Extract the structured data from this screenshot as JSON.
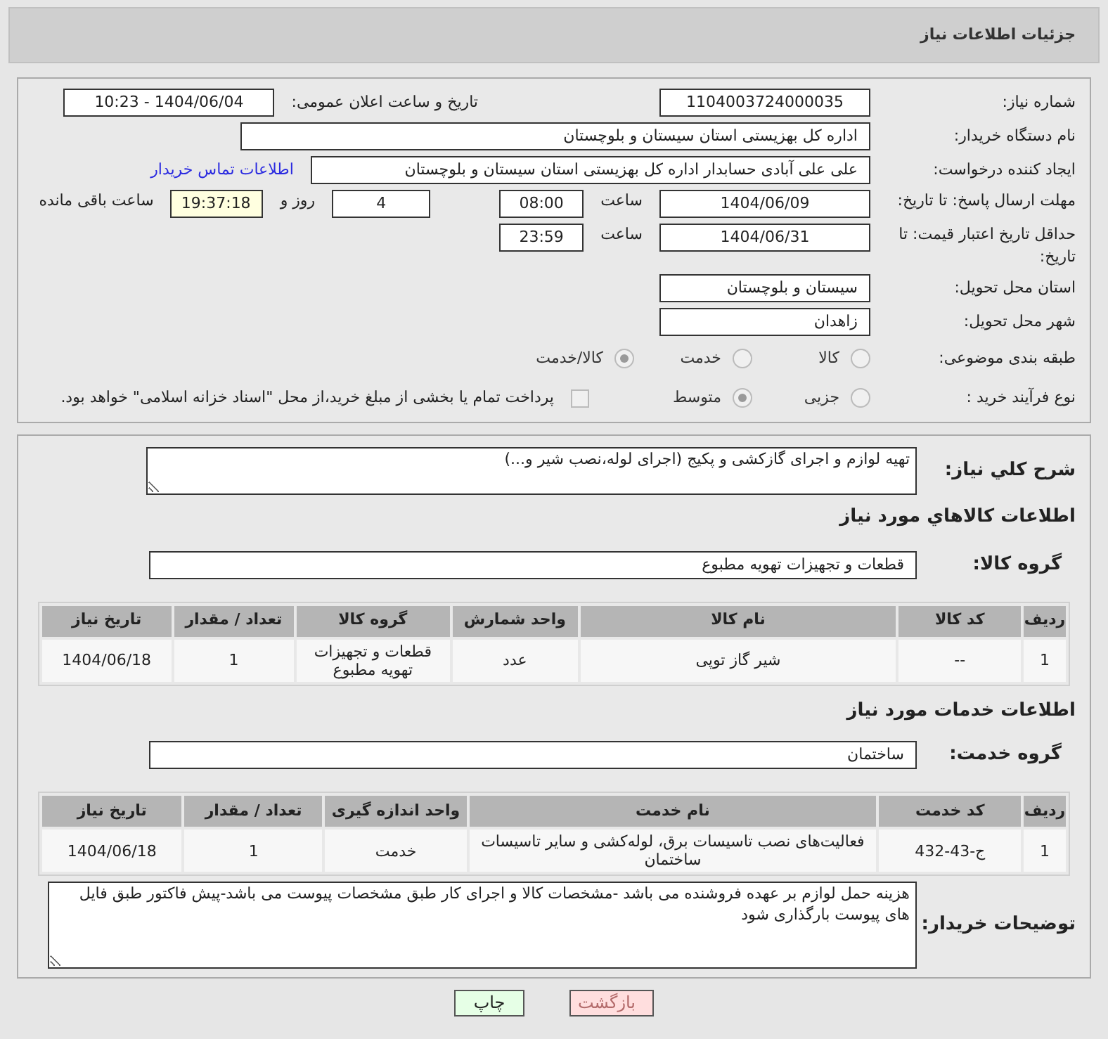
{
  "header": {
    "title": "جزئیات اطلاعات نیاز"
  },
  "need_number": {
    "label": "شماره نیاز:",
    "value": "1104003724000035"
  },
  "announce": {
    "label": "تاریخ و ساعت اعلان عمومی:",
    "value": "1404/06/04 - 10:23"
  },
  "buyer_org": {
    "label": "نام دستگاه خریدار:",
    "value": "اداره کل بهزیستی استان سیستان و بلوچستان"
  },
  "requester": {
    "label": "ایجاد کننده درخواست:",
    "value": "علی علی آبادی حسابدار اداره کل بهزیستی استان سیستان و بلوچستان",
    "link": "اطلاعات تماس خریدار"
  },
  "deadline": {
    "label": "مهلت ارسال پاسخ: تا تاریخ:",
    "date": "1404/06/09",
    "time_label": "ساعت",
    "time": "08:00",
    "days": "4",
    "days_label": "روز و",
    "remaining": "19:37:18",
    "remaining_label": "ساعت باقی مانده"
  },
  "validity": {
    "label": "حداقل تاریخ اعتبار قیمت: تا تاریخ:",
    "date": "1404/06/31",
    "time_label": "ساعت",
    "time": "23:59"
  },
  "province": {
    "label": "استان محل تحویل:",
    "value": "سیستان و بلوچستان"
  },
  "city": {
    "label": "شهر محل تحویل:",
    "value": "زاهدان"
  },
  "category": {
    "label": "طبقه بندی موضوعی:",
    "options": [
      {
        "label": "کالا",
        "selected": false
      },
      {
        "label": "خدمت",
        "selected": false
      },
      {
        "label": "کالا/خدمت",
        "selected": true
      }
    ]
  },
  "process": {
    "label": "نوع فرآیند خرید :",
    "options": [
      {
        "label": "جزیی",
        "selected": false
      },
      {
        "label": "متوسط",
        "selected": true
      }
    ],
    "checkbox": {
      "label": "پرداخت تمام یا بخشی از مبلغ خرید،از محل \"اسناد خزانه اسلامی\" خواهد بود.",
      "checked": false
    }
  },
  "description": {
    "label": "شرح کلي نياز:",
    "value": "تهیه لوازم و اجرای گازکشی و پکیج (اجرای لوله،نصب شیر و...)"
  },
  "goods": {
    "title": "اطلاعات کالاهاي مورد نياز",
    "group_label": "گروه کالا:",
    "group": "قطعات و تجهیزات تهویه مطبوع",
    "columns": [
      "ردیف",
      "کد کالا",
      "نام کالا",
      "واحد شمارش",
      "گروه کالا",
      "تعداد / مقدار",
      "تاریخ نیاز"
    ],
    "rows": [
      [
        "1",
        "--",
        "شیر گاز توپی",
        "عدد",
        "قطعات و تجهیزات تهویه مطبوع",
        "1",
        "1404/06/18"
      ]
    ]
  },
  "services": {
    "title": "اطلاعات خدمات مورد نیاز",
    "group_label": "گروه خدمت:",
    "group": "ساختمان",
    "columns": [
      "ردیف",
      "کد خدمت",
      "نام خدمت",
      "واحد اندازه گیری",
      "تعداد / مقدار",
      "تاریخ نیاز"
    ],
    "rows": [
      [
        "1",
        "ج-43-432",
        "فعالیت‌های نصب تاسیسات برق، لوله‌کشی و سایر تاسیسات ساختمان",
        "خدمت",
        "1",
        "1404/06/18"
      ]
    ]
  },
  "notes": {
    "label": "توضیحات خریدار:",
    "value": "هزینه حمل لوازم بر عهده فروشنده می باشد -مشخصات کالا و اجرای کار طبق مشخصات پیوست می باشد-پیش فاکتور طبق فایل های پیوست بارگذاری شود"
  },
  "buttons": [
    {
      "label": "بازگشت",
      "kind": "back"
    },
    {
      "label": "چاپ",
      "kind": "print"
    }
  ]
}
